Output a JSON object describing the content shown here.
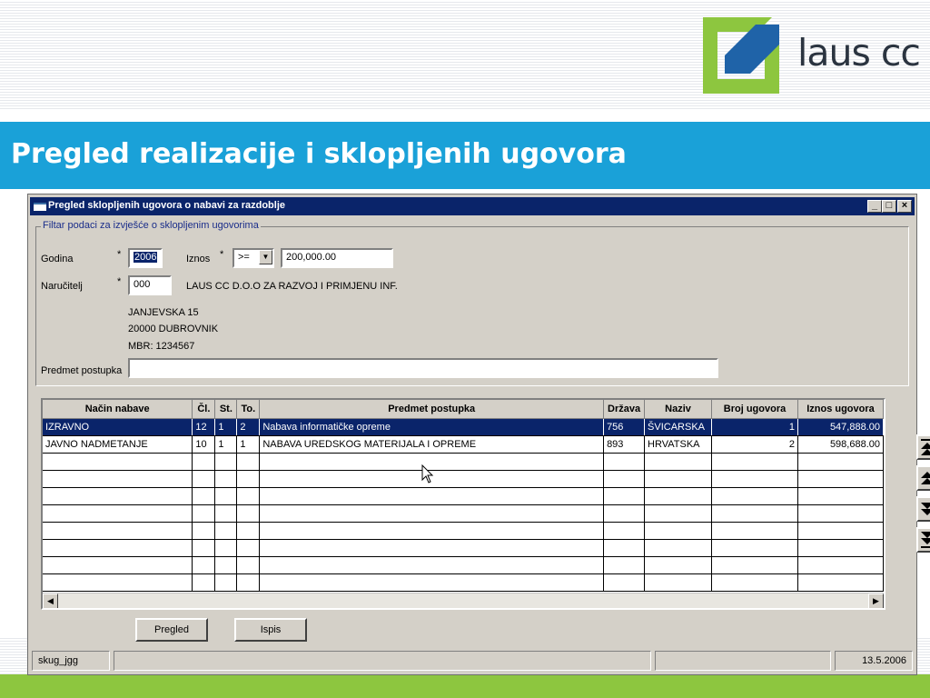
{
  "slide": {
    "title": "Pregled realizacije i sklopljenih ugovora",
    "logo_text": "laus cc",
    "brand_blue": "#1aa1d8",
    "brand_green": "#8dc63f"
  },
  "window": {
    "title": "Pregled sklopljenih ugovora o nabavi za razdoblje",
    "minimize": "_",
    "maximize": "□",
    "close": "×"
  },
  "filter": {
    "legend": "Filtar podaci za izvješće o sklopljenim ugovorima",
    "godina_label": "Godina",
    "godina_value": "2006",
    "required_mark": "*",
    "iznos_label": "Iznos",
    "operator_value": ">=",
    "iznos_value": "200,000.00",
    "narucitelj_label": "Naručitelj",
    "narucitelj_code": "000",
    "narucitelj_name": "LAUS CC D.O.O ZA RAZVOJ I PRIMJENU INF.",
    "address1": "JANJEVSKA 15",
    "address2": "20000 DUBROVNIK",
    "mbr": "MBR:  1234567",
    "predmet_label": "Predmet postupka",
    "predmet_value": ""
  },
  "grid": {
    "headers": [
      "Način nabave",
      "Čl.",
      "St.",
      "To.",
      "Predmet postupka",
      "Država",
      "Naziv",
      "Broj ugovora",
      "Iznos ugovora"
    ],
    "rows": [
      [
        "IZRAVNO",
        "12",
        "1",
        "2",
        "Nabava informatičke opreme",
        "756",
        "ŠVICARSKA",
        "1",
        "547,888.00"
      ],
      [
        "JAVNO NADMETANJE",
        "10",
        "1",
        "1",
        "NABAVA UREDSKOG MATERIJALA I OPREME",
        "893",
        "HRVATSKA",
        "2",
        "598,688.00"
      ]
    ],
    "empty_rows": 8
  },
  "buttons": {
    "pregled": "Pregled",
    "ispis": "Ispis"
  },
  "statusbar": {
    "form_name": "skug_jgg",
    "date": "13.5.2006"
  }
}
